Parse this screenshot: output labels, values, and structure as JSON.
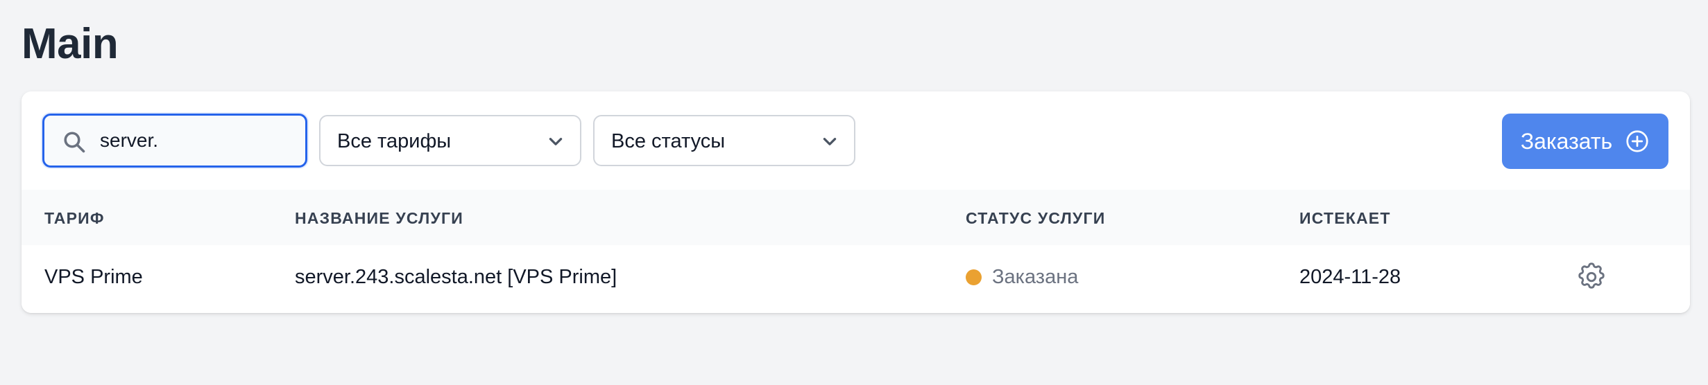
{
  "page": {
    "title": "Main"
  },
  "toolbar": {
    "search": {
      "value": "server."
    },
    "tariff_filter": {
      "selected": "Все тарифы"
    },
    "status_filter": {
      "selected": "Все статусы"
    },
    "order_button": {
      "label": "Заказать"
    }
  },
  "table": {
    "columns": [
      "ТАРИФ",
      "НАЗВАНИЕ УСЛУГИ",
      "СТАТУС УСЛУГИ",
      "ИСТЕКАЕТ"
    ],
    "rows": [
      {
        "tariff": "VPS Prime",
        "service_name": "server.243.scalesta.net [VPS Prime]",
        "status": "Заказана",
        "expires": "2024-11-28"
      }
    ]
  },
  "icons": {
    "search": "search-icon",
    "chevron": "chevron-down-icon",
    "order": "plus-circle-icon",
    "settings": "gear-icon"
  },
  "colors": {
    "accent": "#4f86ed",
    "focus_border": "#2563eb",
    "status_ordered": "#eaa131",
    "background": "#f3f4f6"
  }
}
